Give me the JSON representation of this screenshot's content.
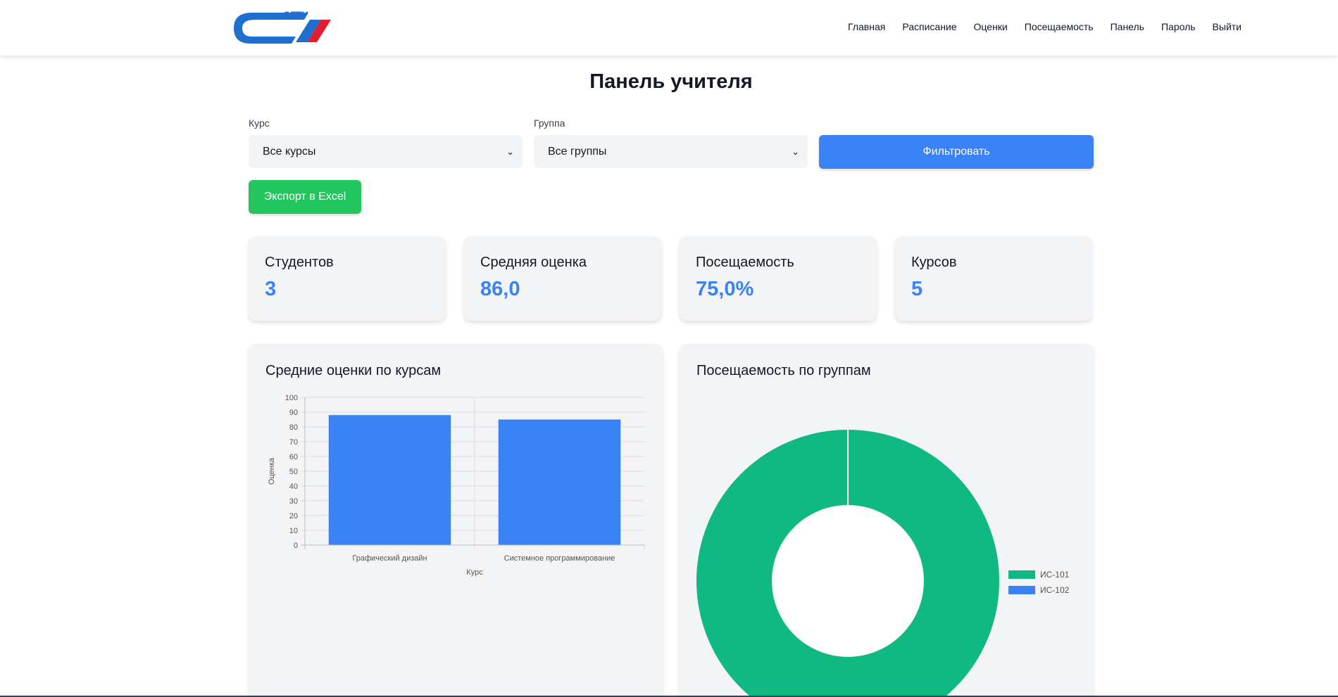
{
  "nav": {
    "logo_text": "СГТУ",
    "items": [
      "Главная",
      "Расписание",
      "Оценки",
      "Посещаемость",
      "Панель",
      "Пароль",
      "Выйти"
    ]
  },
  "page": {
    "title": "Панель учителя"
  },
  "filters": {
    "course_label": "Курс",
    "course_value": "Все курсы",
    "group_label": "Группа",
    "group_value": "Все группы",
    "filter_button": "Фильтровать",
    "export_button": "Экспорт в Excel"
  },
  "stats": [
    {
      "label": "Студентов",
      "value": "3"
    },
    {
      "label": "Средняя оценка",
      "value": "86,0"
    },
    {
      "label": "Посещаемость",
      "value": "75,0%"
    },
    {
      "label": "Курсов",
      "value": "5"
    }
  ],
  "colors": {
    "primary": "#3b82f6",
    "success": "#22c55e",
    "teal": "#10b981",
    "card_bg": "#f3f4f6"
  },
  "chart_data": [
    {
      "type": "bar",
      "title": "Средние оценки по курсам",
      "categories": [
        "Графический дизайн",
        "Системное программирование"
      ],
      "values": [
        88,
        85
      ],
      "xlabel": "Курс",
      "ylabel": "Оценка",
      "ylim": [
        0,
        100
      ],
      "yticks": [
        0,
        10,
        20,
        30,
        40,
        50,
        60,
        70,
        80,
        90,
        100
      ],
      "grid": true,
      "color": "#3b82f6"
    },
    {
      "type": "pie",
      "title": "Посещаемость по группам",
      "labels": [
        "ИС-101",
        "ИС-102"
      ],
      "values": [
        100,
        0
      ],
      "colors": [
        "#10b981",
        "#3b82f6"
      ],
      "legend": "right"
    }
  ]
}
